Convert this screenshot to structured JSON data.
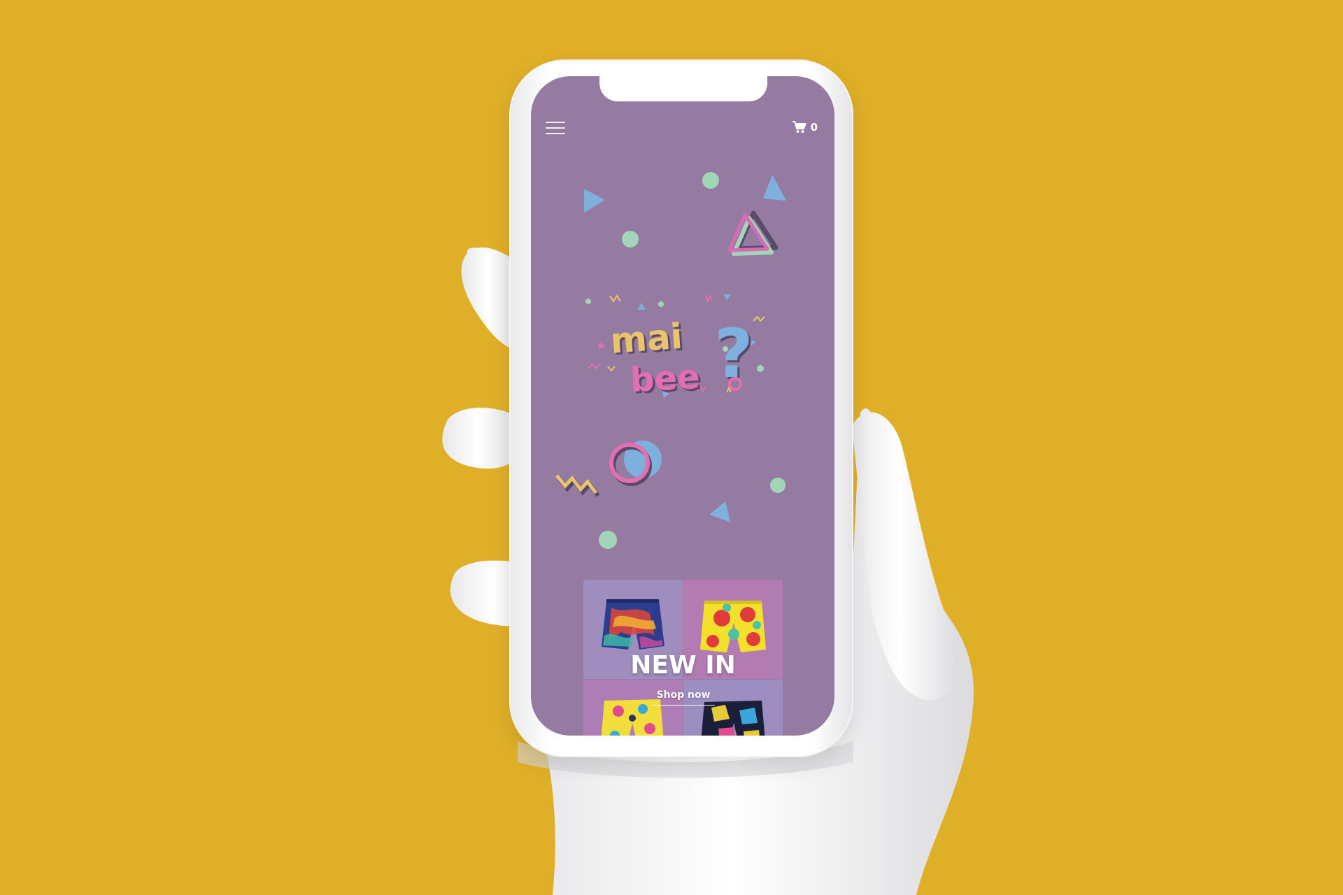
{
  "background_color": "#E0AF28",
  "screen_color": "#957BA2",
  "header": {
    "menu_icon": "hamburger-menu-icon",
    "cart_icon": "shopping-cart-icon",
    "cart_count": "0"
  },
  "logo": {
    "line1": "mai",
    "line2": "bee",
    "mark": "?",
    "colors": {
      "yellow": "#E9C46A",
      "pink": "#E46FB0",
      "green": "#9CD3B4",
      "blue": "#7FB1E0"
    }
  },
  "promo": {
    "title": "NEW IN",
    "link_label": "Shop now",
    "tile_colors": [
      "#9F8DBE",
      "#B27CB2",
      "#AE7DB6",
      "#9C8EC0"
    ]
  }
}
